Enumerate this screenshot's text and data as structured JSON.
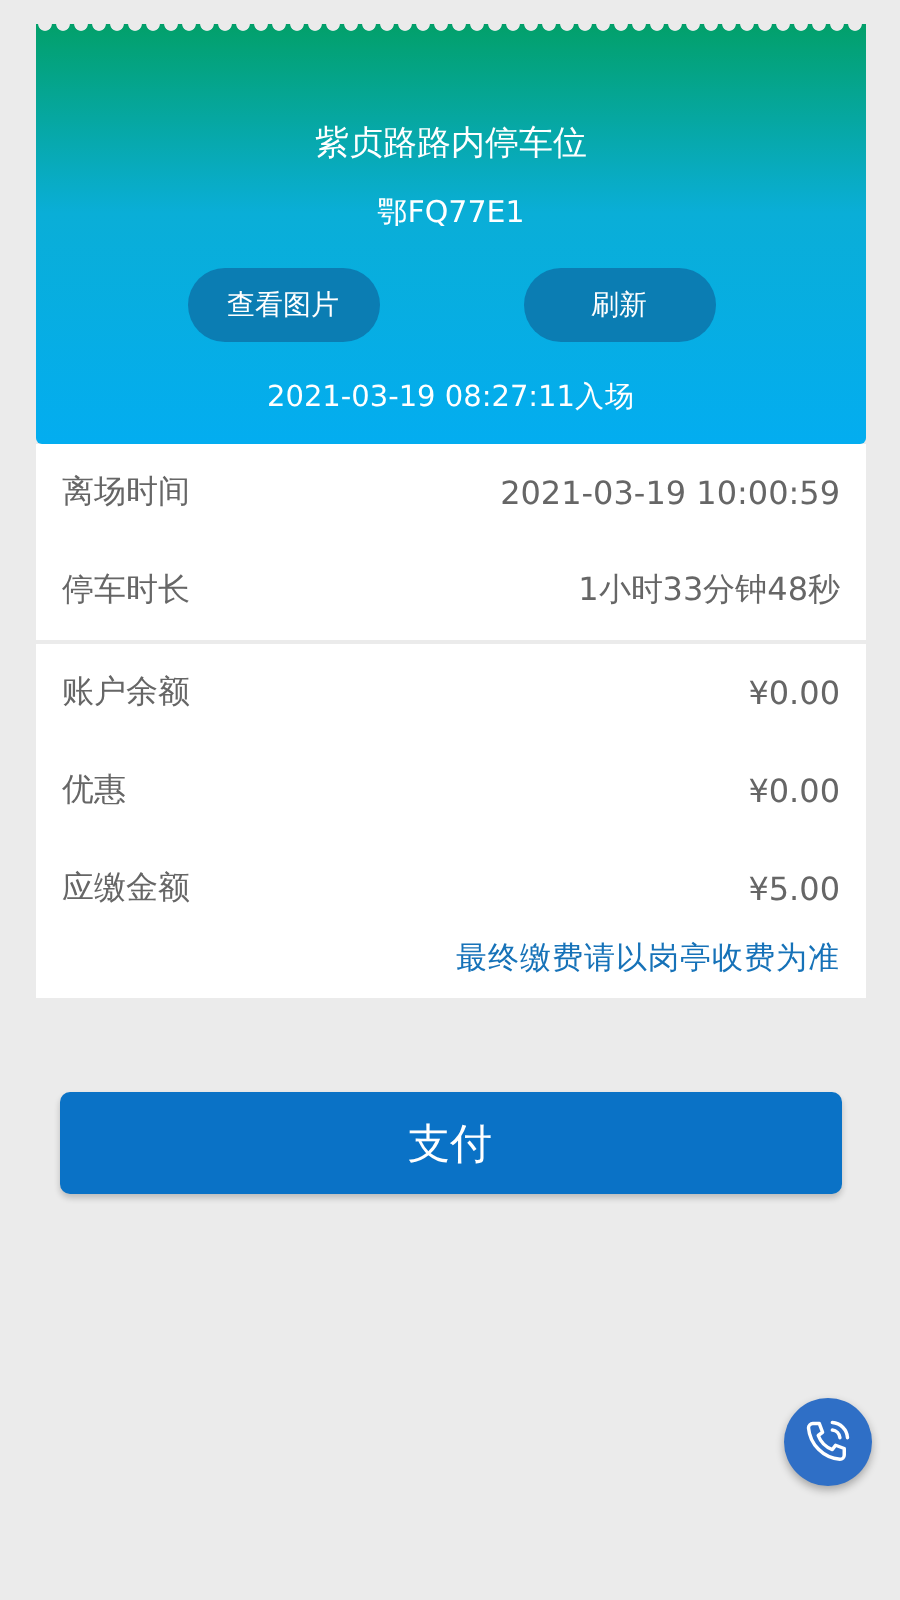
{
  "header": {
    "location": "紫贞路路内停车位",
    "plate": "鄂FQ77E1",
    "buttons": [
      "查看图片",
      "刷新"
    ],
    "entry_time": "2021-03-19 08:27:11入场"
  },
  "sections": [
    {
      "rows": [
        {
          "label": "离场时间",
          "value": "2021-03-19 10:00:59"
        },
        {
          "label": "停车时长",
          "value": "1小时33分钟48秒"
        }
      ]
    },
    {
      "rows": [
        {
          "label": "账户余额",
          "value": "¥0.00"
        },
        {
          "label": "优惠",
          "value": "¥0.00"
        },
        {
          "label": "应缴金额",
          "value": "¥5.00"
        }
      ],
      "notice": "最终缴费请以岗亭收费为准"
    }
  ],
  "pay_button": "支付"
}
